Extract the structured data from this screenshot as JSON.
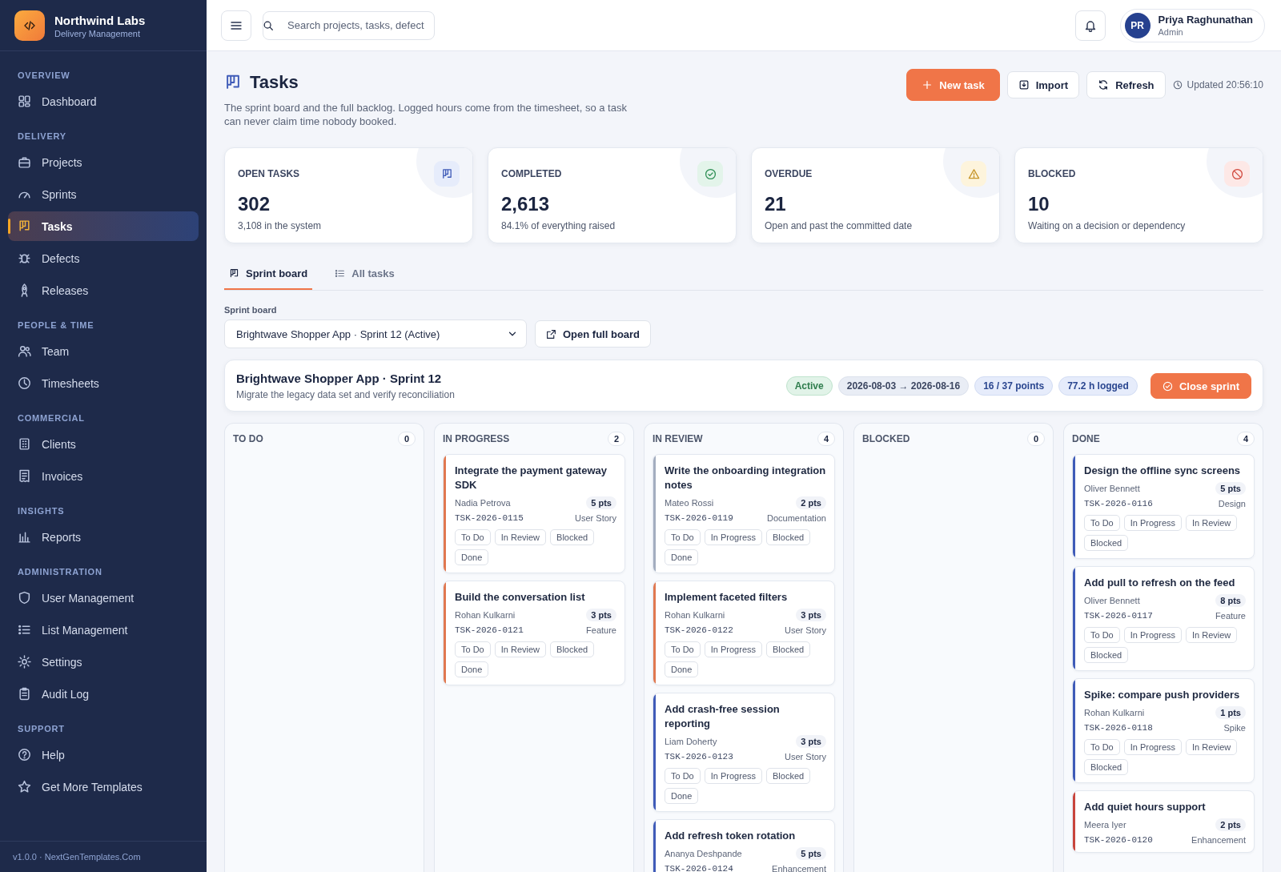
{
  "brand": {
    "name": "Northwind Labs",
    "subtitle": "Delivery Management"
  },
  "sidebar": {
    "sections": [
      {
        "label": "OVERVIEW",
        "items": [
          {
            "label": "Dashboard",
            "selected": false
          }
        ]
      },
      {
        "label": "DELIVERY",
        "items": [
          {
            "label": "Projects",
            "selected": false
          },
          {
            "label": "Sprints",
            "selected": false
          },
          {
            "label": "Tasks",
            "selected": true
          },
          {
            "label": "Defects",
            "selected": false
          },
          {
            "label": "Releases",
            "selected": false
          }
        ]
      },
      {
        "label": "PEOPLE & TIME",
        "items": [
          {
            "label": "Team",
            "selected": false
          },
          {
            "label": "Timesheets",
            "selected": false
          }
        ]
      },
      {
        "label": "COMMERCIAL",
        "items": [
          {
            "label": "Clients",
            "selected": false
          },
          {
            "label": "Invoices",
            "selected": false
          }
        ]
      },
      {
        "label": "INSIGHTS",
        "items": [
          {
            "label": "Reports",
            "selected": false
          }
        ]
      },
      {
        "label": "ADMINISTRATION",
        "items": [
          {
            "label": "User Management",
            "selected": false
          },
          {
            "label": "List Management",
            "selected": false
          },
          {
            "label": "Settings",
            "selected": false
          },
          {
            "label": "Audit Log",
            "selected": false
          }
        ]
      },
      {
        "label": "SUPPORT",
        "items": [
          {
            "label": "Help",
            "selected": false
          },
          {
            "label": "Get More Templates",
            "selected": false
          }
        ]
      }
    ],
    "footer": "v1.0.0 · NextGenTemplates.Com"
  },
  "topbar": {
    "search": {
      "placeholder": "Search projects, tasks, defect"
    },
    "user": {
      "initials": "PR",
      "name": "Priya Raghunathan",
      "role": "Admin"
    }
  },
  "page": {
    "title": "Tasks",
    "description": "The sprint board and the full backlog. Logged hours come from the timesheet, so a task can never claim time nobody booked.",
    "buttons": [
      "New task",
      "Import",
      "Refresh"
    ],
    "updated": "Updated 20:56:10"
  },
  "stats": [
    {
      "label": "OPEN TASKS",
      "value": "302",
      "note": "3,108 in the system"
    },
    {
      "label": "COMPLETED",
      "value": "2,613",
      "note": "84.1% of everything raised"
    },
    {
      "label": "OVERDUE",
      "value": "21",
      "note": "Open and past the committed date"
    },
    {
      "label": "BLOCKED",
      "value": "10",
      "note": "Waiting on a decision or dependency"
    }
  ],
  "tabs": [
    {
      "label": "Sprint board",
      "selected": true
    },
    {
      "label": "All tasks",
      "selected": false
    }
  ],
  "sprint_picker": {
    "label": "Sprint board",
    "value": "Brightwave Shopper App · Sprint 12 (Active)",
    "button": "Open full board"
  },
  "sprint": {
    "title": "Brightwave Shopper App · Sprint 12",
    "subtitle": "Migrate the legacy data set and verify reconciliation",
    "status": "Active",
    "dates": "2026-08-03 → 2026-08-16",
    "points": "16 / 37 points",
    "logged": "77.2 h logged",
    "button": "Close sprint"
  },
  "columns": [
    {
      "title": "TO DO",
      "count": "0"
    },
    {
      "title": "IN PROGRESS",
      "count": "2",
      "tasks": [
        {
          "title": "Integrate the payment gateway SDK",
          "assignee": "Nadia Petrova",
          "points": "5 pts",
          "id": "TSK-2026-0115",
          "type": "User Story",
          "color": "#e07850",
          "actions": [
            "To Do",
            "In Review",
            "Blocked",
            "Done"
          ]
        },
        {
          "title": "Build the conversation list",
          "assignee": "Rohan Kulkarni",
          "points": "3 pts",
          "id": "TSK-2026-0121",
          "type": "Feature",
          "color": "#e07850",
          "actions": [
            "To Do",
            "In Review",
            "Blocked",
            "Done"
          ]
        }
      ]
    },
    {
      "title": "IN REVIEW",
      "count": "4",
      "tasks": [
        {
          "title": "Write the onboarding integration notes",
          "assignee": "Mateo Rossi",
          "points": "2 pts",
          "id": "TSK-2026-0119",
          "type": "Documentation",
          "color": "#a3adbf",
          "actions": [
            "To Do",
            "In Progress",
            "Blocked",
            "Done"
          ]
        },
        {
          "title": "Implement faceted filters",
          "assignee": "Rohan Kulkarni",
          "points": "3 pts",
          "id": "TSK-2026-0122",
          "type": "User Story",
          "color": "#e07850",
          "actions": [
            "To Do",
            "In Progress",
            "Blocked",
            "Done"
          ]
        },
        {
          "title": "Add crash-free session reporting",
          "assignee": "Liam Doherty",
          "points": "3 pts",
          "id": "TSK-2026-0123",
          "type": "User Story",
          "color": "#3f5bb8",
          "actions": [
            "To Do",
            "In Progress",
            "Blocked",
            "Done"
          ]
        },
        {
          "title": "Add refresh token rotation",
          "assignee": "Ananya Deshpande",
          "points": "5 pts",
          "id": "TSK-2026-0124",
          "type": "Enhancement",
          "color": "#3f5bb8"
        }
      ]
    },
    {
      "title": "BLOCKED",
      "count": "0"
    },
    {
      "title": "DONE",
      "count": "4",
      "tasks": [
        {
          "title": "Design the offline sync screens",
          "assignee": "Oliver Bennett",
          "points": "5 pts",
          "id": "TSK-2026-0116",
          "type": "Design",
          "color": "#3f5bb8",
          "actions": [
            "To Do",
            "In Progress",
            "In Review",
            "Blocked"
          ]
        },
        {
          "title": "Add pull to refresh on the feed",
          "assignee": "Oliver Bennett",
          "points": "8 pts",
          "id": "TSK-2026-0117",
          "type": "Feature",
          "color": "#3f5bb8",
          "actions": [
            "To Do",
            "In Progress",
            "In Review",
            "Blocked"
          ]
        },
        {
          "title": "Spike: compare push providers",
          "assignee": "Rohan Kulkarni",
          "points": "1 pts",
          "id": "TSK-2026-0118",
          "type": "Spike",
          "color": "#3f5bb8",
          "actions": [
            "To Do",
            "In Progress",
            "In Review",
            "Blocked"
          ]
        },
        {
          "title": "Add quiet hours support",
          "assignee": "Meera Iyer",
          "points": "2 pts",
          "id": "TSK-2026-0120",
          "type": "Enhancement",
          "color": "#c8453c"
        }
      ]
    }
  ]
}
